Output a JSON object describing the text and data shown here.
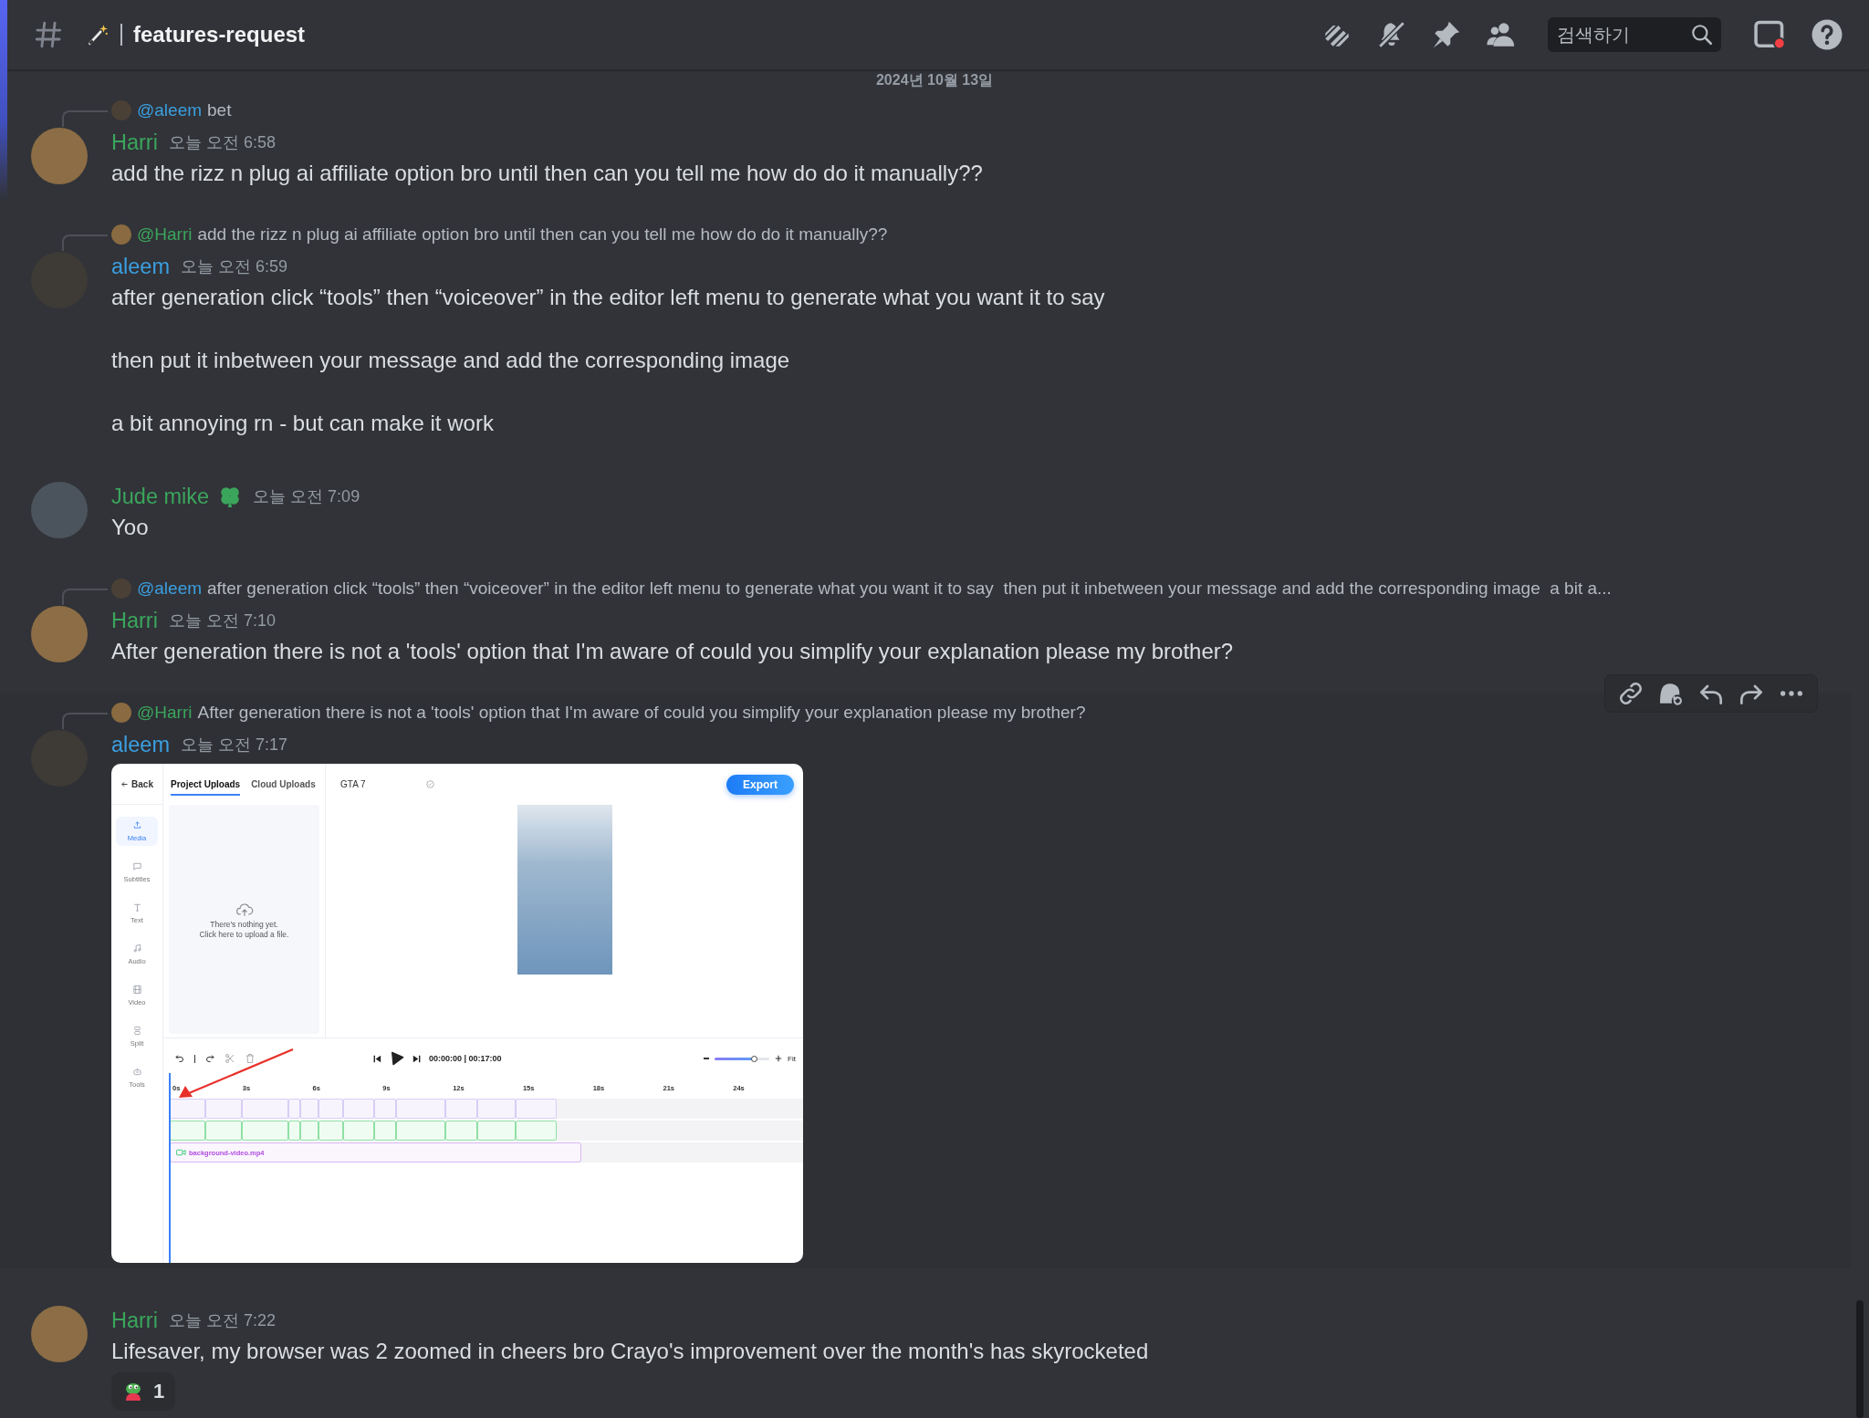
{
  "channel": {
    "name": "features-request",
    "search": {
      "placeholder": "검색하기"
    }
  },
  "date_divider": "2024년 10월 13일",
  "messages": [
    {
      "author": "Harri",
      "color": "#3ba55c",
      "timestamp": "오늘 오전 6:58",
      "badge": false,
      "hovered": false,
      "reply": {
        "author": "@aleem",
        "color": "#3b9fe0",
        "text": "bet"
      },
      "paragraphs": [
        "add the rizz n plug ai affiliate option bro until then can you tell me how do do it manually??"
      ]
    },
    {
      "author": "aleem",
      "color": "#3b9fe0",
      "timestamp": "오늘 오전 6:59",
      "badge": false,
      "hovered": false,
      "reply": {
        "author": "@Harri",
        "color": "#3ba55c",
        "text": "add the rizz n plug ai affiliate option bro until then can you tell me how do do it manually??"
      },
      "paragraphs": [
        "after generation click “tools” then “voiceover” in the editor left menu to generate what you want it to say",
        "then put it inbetween your message and add the corresponding image",
        "a bit annoying rn - but can make it work"
      ]
    },
    {
      "author": "Jude mike",
      "color": "#3ba55c",
      "timestamp": "오늘 오전 7:09",
      "badge": true,
      "hovered": false,
      "paragraphs": [
        "Yoo"
      ]
    },
    {
      "author": "Harri",
      "color": "#3ba55c",
      "timestamp": "오늘 오전 7:10",
      "badge": false,
      "hovered": false,
      "reply": {
        "author": "@aleem",
        "color": "#3b9fe0",
        "text": "after generation click “tools” then “voiceover” in the editor left menu to generate what you want it to say  then put it inbetween your message and add the corresponding image  a bit a..."
      },
      "paragraphs": [
        "After generation there is not a 'tools' option that I'm aware of could you simplify your explanation please my brother?"
      ]
    },
    {
      "author": "aleem",
      "color": "#3b9fe0",
      "timestamp": "오늘 오전 7:17",
      "badge": false,
      "hovered": true,
      "reply": {
        "author": "@Harri",
        "color": "#3ba55c",
        "text": "After generation there is not a 'tools' option that I'm aware of could you simplify your explanation please my brother?"
      },
      "attachment": {
        "kind": "editor_screenshot",
        "back": "Back",
        "tabs": [
          {
            "label": "Project Uploads",
            "selected": true
          },
          {
            "label": "Cloud Uploads",
            "selected": false
          }
        ],
        "tools": [
          {
            "label": "Media",
            "selected": true
          },
          {
            "label": "Subtitles",
            "selected": false
          },
          {
            "label": "Text",
            "selected": false
          },
          {
            "label": "Audio",
            "selected": false
          },
          {
            "label": "Video",
            "selected": false
          },
          {
            "label": "Split",
            "selected": false
          },
          {
            "label": "Tools",
            "selected": false
          }
        ],
        "empty_lines": [
          "There's nothing yet.",
          "Click here to upload a file."
        ],
        "project_name": "GTA 7",
        "export": "Export",
        "timecode": "00:00:00 | 00:17:00",
        "zoom": {
          "level": 0.73,
          "fit": "Fit"
        },
        "ruler": [
          "0s",
          "3s",
          "6s",
          "9s",
          "12s",
          "15s",
          "18s",
          "21s",
          "24s"
        ],
        "clip": "background-video.mp4"
      }
    },
    {
      "author": "Harri",
      "color": "#3ba55c",
      "timestamp": "오늘 오전 7:22",
      "badge": false,
      "hovered": false,
      "paragraphs": [
        "Lifesaver, my browser was 2 zoomed in cheers bro Crayo's improvement over the month's has skyrocketed"
      ],
      "reactions": [
        {
          "count": "1"
        }
      ]
    }
  ]
}
